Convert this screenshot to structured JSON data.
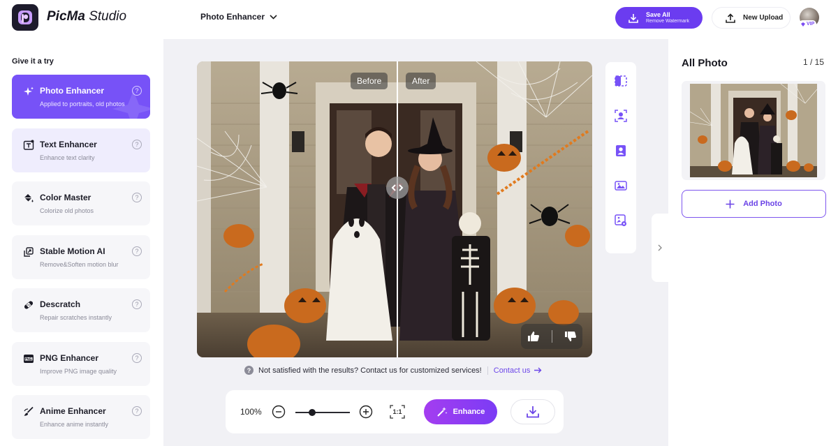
{
  "header": {
    "brand_bold": "PicMa",
    "brand_light": "Studio",
    "tool_selector": "Photo Enhancer",
    "save_all": "Save All",
    "save_all_sub": "Remove Watermark",
    "new_upload": "New Upload",
    "vip_label": "VIP"
  },
  "sidebar": {
    "heading": "Give it a try",
    "items": [
      {
        "title": "Photo Enhancer",
        "desc": "Applied to portraits, old photos",
        "icon": "sparkle-icon",
        "state": "active"
      },
      {
        "title": "Text Enhancer",
        "desc": "Enhance text clarity",
        "icon": "text-icon",
        "state": "hover"
      },
      {
        "title": "Color Master",
        "desc": "Colorize old photos",
        "icon": "paint-bucket-icon",
        "state": "normal"
      },
      {
        "title": "Stable Motion AI",
        "desc": "Remove&Soften motion blur",
        "icon": "motion-icon",
        "state": "normal"
      },
      {
        "title": "Descratch",
        "desc": "Repair scratches instantly",
        "icon": "bandage-icon",
        "state": "normal"
      },
      {
        "title": "PNG Enhancer",
        "desc": "Improve PNG image quality",
        "icon": "png-icon",
        "state": "normal"
      },
      {
        "title": "Anime Enhancer",
        "desc": "Enhance anime instantly",
        "icon": "brush-icon",
        "state": "normal"
      }
    ],
    "help_glyph": "?"
  },
  "canvas": {
    "before_label": "Before",
    "after_label": "After",
    "notice": "Not satisfied with the results? Contact us for customized services!",
    "contact_link": "Contact us",
    "zoom": "100%",
    "one_to_one": "1:1",
    "enhance": "Enhance",
    "slider_value": 0.28
  },
  "right_panel": {
    "title": "All Photo",
    "count": "1 / 15",
    "add_photo": "Add Photo"
  },
  "colors": {
    "accent": "#7752f7",
    "brand_dark": "#1d1b2c",
    "enhance_gradient_start": "#a43df0",
    "enhance_gradient_end": "#7b3cf5"
  }
}
